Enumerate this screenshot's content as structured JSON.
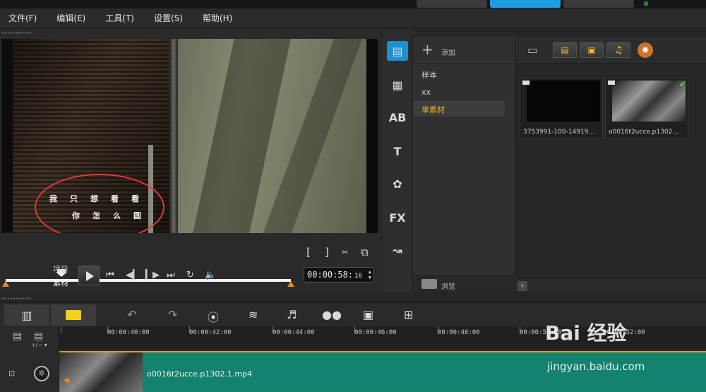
{
  "menu": [
    "文件(F)",
    "编辑(E)",
    "工具(T)",
    "设置(S)",
    "帮助(H)"
  ],
  "preview": {
    "subtitle_line1": "我只想看看",
    "subtitle_line2": "你怎么圆",
    "mode_project": "项目",
    "mode_clip": "素材",
    "timecode_main": "00:00:58:",
    "timecode_frames": "16",
    "mark_in": "[",
    "mark_out": "]"
  },
  "side_icons": [
    "media-icon",
    "instant-project-icon",
    "transition-icon",
    "title-icon",
    "graphic-icon",
    "filter-icon",
    "path-icon"
  ],
  "folders": {
    "add_label": "添加",
    "items": [
      "样本",
      "xx",
      "单素材"
    ],
    "selected_index": 2,
    "browse_label": "浏览"
  },
  "library": {
    "thumbs": [
      {
        "label": "3753991-100-14919..."
      },
      {
        "label": "o0016t2ucce.p1302..."
      }
    ]
  },
  "timeline": {
    "ticks": [
      "00:00:40:00",
      "00:00:42:00",
      "00:00:44:00",
      "00:00:46:00",
      "00:00:48:00",
      "00:00:50:00",
      "00:00:52:00"
    ],
    "clip_label": "o0016t2ucce.p1302.1.mp4"
  },
  "watermark": {
    "brand": "Bai 经验",
    "url": "jingyan.baidu.com"
  },
  "colors": {
    "accent": "#1f9de2",
    "selected_folder": "#f2b61e",
    "track": "#14826e",
    "marker": "#f08a1c"
  }
}
